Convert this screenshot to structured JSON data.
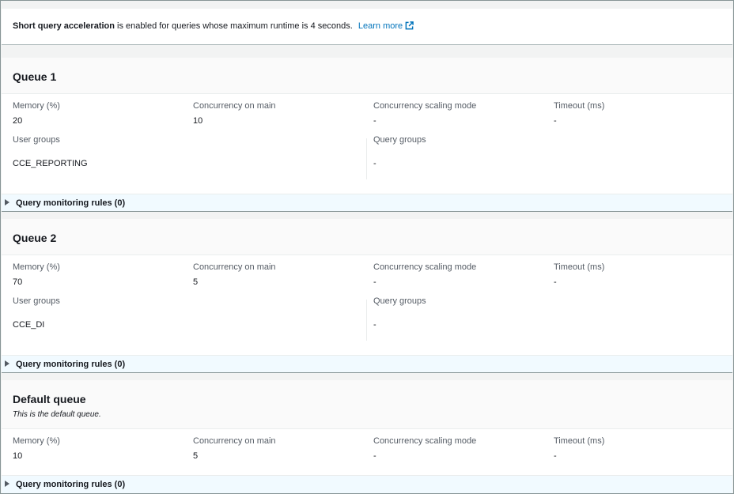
{
  "sqa": {
    "bold": "Short query acceleration",
    "text": " is enabled for queries whose maximum runtime is 4 seconds.",
    "learn_more": "Learn more"
  },
  "labels": {
    "memory": "Memory (%)",
    "concurrency": "Concurrency on main",
    "scaling": "Concurrency scaling mode",
    "timeout": "Timeout (ms)",
    "user_groups": "User groups",
    "query_groups": "Query groups"
  },
  "queues": [
    {
      "title": "Queue 1",
      "memory": "20",
      "concurrency": "10",
      "scaling": "-",
      "timeout": "-",
      "user_groups": "CCE_REPORTING",
      "query_groups": "-",
      "qmr": "Query monitoring rules (0)"
    },
    {
      "title": "Queue 2",
      "memory": "70",
      "concurrency": "5",
      "scaling": "-",
      "timeout": "-",
      "user_groups": "CCE_DI",
      "query_groups": "-",
      "qmr": "Query monitoring rules (0)"
    },
    {
      "title": "Default queue",
      "subtitle": "This is the default queue.",
      "memory": "10",
      "concurrency": "5",
      "scaling": "-",
      "timeout": "-",
      "qmr": "Query monitoring rules (0)"
    }
  ]
}
